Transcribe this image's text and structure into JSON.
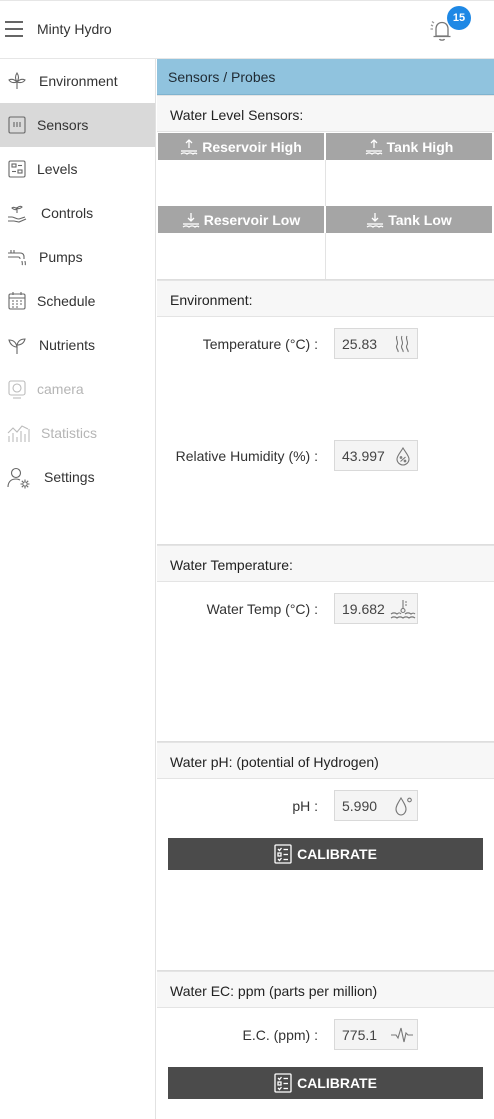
{
  "app": {
    "title": "Minty Hydro",
    "notification_count": "15"
  },
  "sidebar": {
    "items": [
      {
        "label": "Environment",
        "icon": "leaf-icon"
      },
      {
        "label": "Sensors",
        "icon": "sensor-icon",
        "active": true
      },
      {
        "label": "Levels",
        "icon": "levels-icon"
      },
      {
        "label": "Controls",
        "icon": "plant-hand-icon"
      },
      {
        "label": "Pumps",
        "icon": "pump-icon"
      },
      {
        "label": "Schedule",
        "icon": "calendar-icon"
      },
      {
        "label": "Nutrients",
        "icon": "sprout-icon"
      },
      {
        "label": "camera",
        "icon": "camera-icon",
        "disabled": true
      },
      {
        "label": "Statistics",
        "icon": "chart-icon",
        "disabled": true
      },
      {
        "label": "Settings",
        "icon": "user-gear-icon"
      }
    ]
  },
  "main": {
    "title": "Sensors / Probes",
    "water_level": {
      "title": "Water Level Sensors:",
      "reservoir_high": "Reservoir High",
      "tank_high": "Tank High",
      "reservoir_low": "Reservoir Low",
      "tank_low": "Tank Low"
    },
    "environment": {
      "title": "Environment:",
      "temperature_label": "Temperature (°C) :",
      "temperature_value": "25.83",
      "humidity_label": "Relative Humidity (%) :",
      "humidity_value": "43.997"
    },
    "water_temp": {
      "title": "Water Temperature:",
      "label": "Water Temp (°C) :",
      "value": "19.682"
    },
    "ph": {
      "title": "Water pH: (potential of Hydrogen)",
      "label": "pH :",
      "value": "5.990",
      "calibrate": "CALIBRATE"
    },
    "ec": {
      "title": "Water EC: ppm (parts per million)",
      "label": "E.C. (ppm) :",
      "value": "775.1",
      "calibrate": "CALIBRATE"
    }
  },
  "colors": {
    "accent_header": "#90c3de",
    "badge": "#1e88e5",
    "button": "#4b4b4b",
    "level_header": "#a5a5a5",
    "active_nav": "#d9d9d9"
  }
}
